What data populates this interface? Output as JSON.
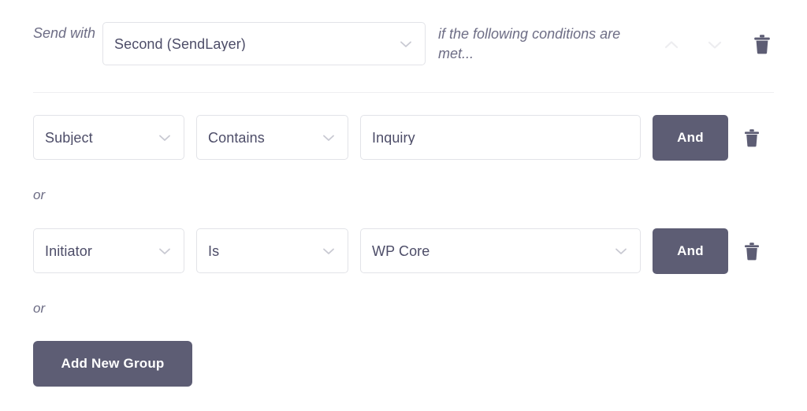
{
  "colors": {
    "accent_button": "#5d5d74",
    "field_border": "#e2e3e8",
    "text": "#4d4d68",
    "muted_text": "#6d6d85",
    "chevron": "#c8c9d2",
    "disabled_chevron": "#ededf0",
    "divider": "#eeeef1"
  },
  "rule_header": {
    "send_with_label": "Send with",
    "provider": {
      "value": "Second (SendLayer)",
      "icon": "chevron-down-icon"
    },
    "conditions_note": "if the following conditions are met...",
    "move_up_icon": "chevron-up-icon",
    "move_down_icon": "chevron-down-icon",
    "delete_icon": "trash-icon"
  },
  "conditions": {
    "rows": [
      {
        "subject": {
          "value": "Subject",
          "type": "select",
          "icon": "chevron-down-icon"
        },
        "operator": {
          "value": "Contains",
          "type": "select",
          "icon": "chevron-down-icon"
        },
        "value": {
          "value": "Inquiry",
          "type": "text",
          "placeholder": ""
        },
        "logic_button": "And",
        "delete_icon": "trash-icon"
      },
      {
        "subject": {
          "value": "Initiator",
          "type": "select",
          "icon": "chevron-down-icon"
        },
        "operator": {
          "value": "Is",
          "type": "select",
          "icon": "chevron-down-icon"
        },
        "value": {
          "value": "WP Core",
          "type": "select",
          "icon": "chevron-down-icon"
        },
        "logic_button": "And",
        "delete_icon": "trash-icon"
      }
    ],
    "separators": [
      "or",
      "or"
    ],
    "add_group_label": "Add New Group"
  }
}
